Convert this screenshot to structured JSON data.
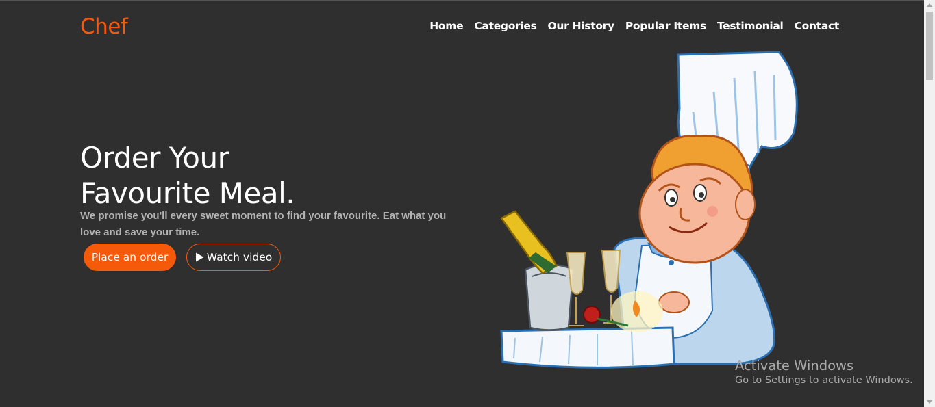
{
  "header": {
    "logo": "Chef",
    "nav": [
      "Home",
      "Categories",
      "Our History",
      "Popular Items",
      "Testimonial",
      "Contact"
    ]
  },
  "hero": {
    "title_line1": "Order Your",
    "title_line2": "Favourite Meal.",
    "description": "We promise you'll every sweet moment to find your favourite. Eat what you love and save your time.",
    "order_button": "Place an order",
    "video_button": "Watch video"
  },
  "illustration": {
    "icon": "chef-illustration-icon"
  },
  "watermark": {
    "title": "Activate Windows",
    "subtitle": "Go to Settings to activate Windows."
  },
  "colors": {
    "accent": "#f45a0a",
    "background": "#2f2f2f",
    "text": "#ffffff",
    "muted_text": "#b3b3b3"
  }
}
